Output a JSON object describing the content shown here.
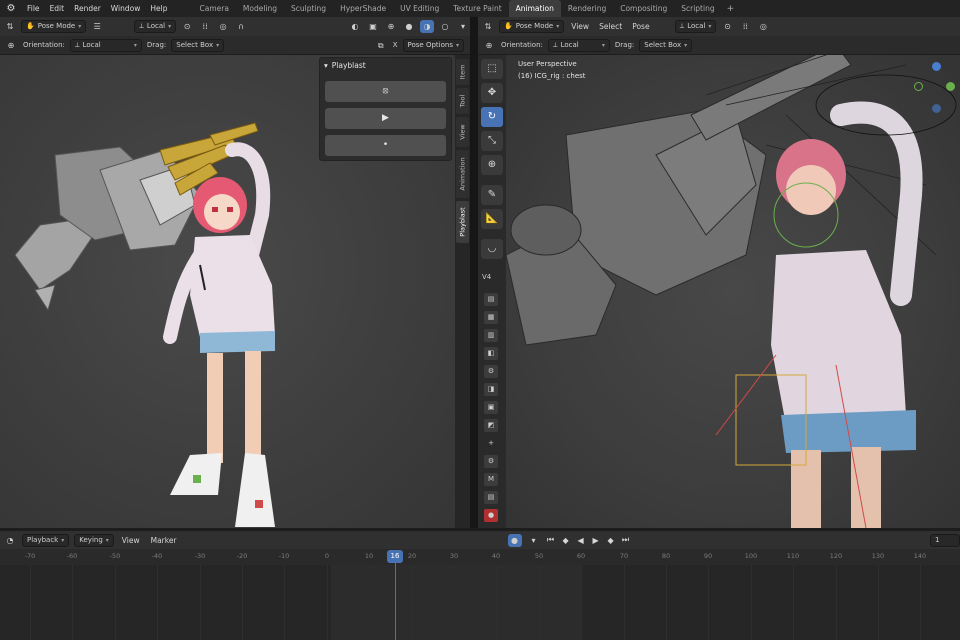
{
  "topbar": {
    "menus": [
      "File",
      "Edit",
      "Render",
      "Window",
      "Help"
    ],
    "workspaces": [
      "Camera",
      "Modeling",
      "Sculpting",
      "HyperShade",
      "UV Editing",
      "Texture Paint",
      "Animation",
      "Rendering",
      "Compositing",
      "Scripting"
    ],
    "active_workspace": "Animation",
    "add": "+"
  },
  "left_viewport": {
    "mode": "Pose Mode",
    "transform": "Local",
    "orientation_label": "Orientation:",
    "orientation_value": "Local",
    "drag_label": "Drag:",
    "drag_value": "Select Box",
    "x_label": "X",
    "pose_options": "Pose Options",
    "side_tabs": [
      "Item",
      "Tool",
      "View",
      "Animation",
      "Playblast"
    ],
    "active_side_tab": "Playblast"
  },
  "playblast_panel": {
    "title": "Playblast",
    "buttons": [
      "⦻",
      "▶",
      "•"
    ]
  },
  "right_viewport": {
    "mode": "Pose Mode",
    "menus": [
      "View",
      "Select",
      "Pose"
    ],
    "transform": "Local",
    "orientation_label": "Orientation:",
    "orientation_value": "Local",
    "drag_label": "Drag:",
    "drag_value": "Select Box",
    "perspective": "User Perspective",
    "active_bone": "(16) ICG_rig : chest",
    "toolbar_group_label": "V4"
  },
  "timeline": {
    "menus": [
      "Playback",
      "Keying",
      "View",
      "Marker"
    ],
    "current_frame": "16",
    "start_frame": "1",
    "ticks": [
      "-70",
      "-60",
      "-50",
      "-40",
      "-30",
      "-20",
      "-10",
      "0",
      "10",
      "20",
      "30",
      "40",
      "50",
      "60",
      "70",
      "80",
      "90",
      "100",
      "110",
      "120",
      "130",
      "140"
    ]
  },
  "colors": {
    "accent": "#4772b3",
    "axis_x": "#d04a4a",
    "axis_y": "#6ab04c",
    "axis_z": "#4a7ed0"
  }
}
